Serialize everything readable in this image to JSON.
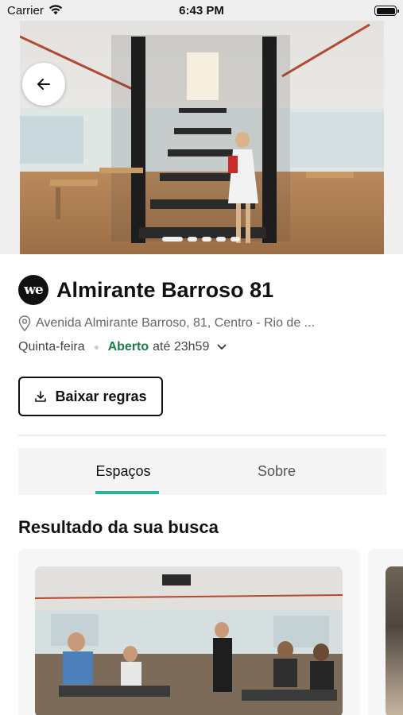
{
  "status_bar": {
    "carrier": "Carrier",
    "time": "6:43 PM"
  },
  "hero": {
    "back_icon": "arrow-left-icon",
    "carousel_pages": 6
  },
  "location": {
    "logo_text": "we",
    "title": "Almirante Barroso 81",
    "address": "Avenida Almirante Barroso, 81, Centro - Rio de ...",
    "day": "Quinta-feira",
    "status": "Aberto",
    "until": "até 23h59"
  },
  "actions": {
    "download_label": "Baixar regras"
  },
  "tabs": [
    {
      "label": "Espaços",
      "active": true
    },
    {
      "label": "Sobre",
      "active": false
    }
  ],
  "results": {
    "section_title": "Resultado da sua busca"
  },
  "colors": {
    "accent": "#2bb39b",
    "open_status": "#1e7a4a"
  }
}
